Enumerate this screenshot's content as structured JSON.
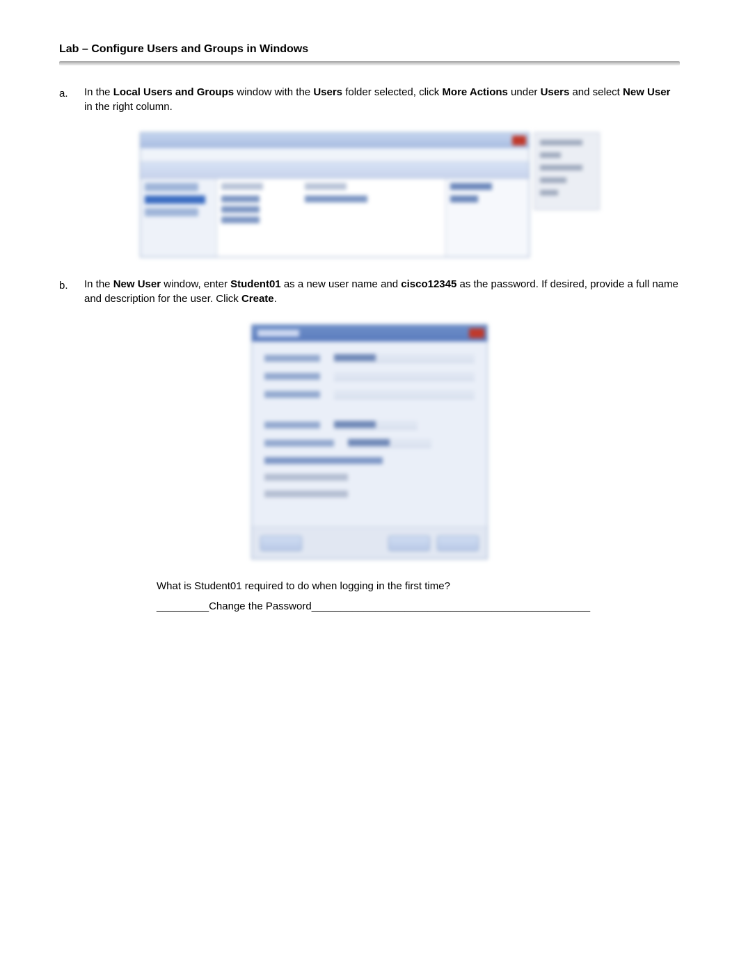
{
  "header": {
    "title": "Lab – Configure Users and Groups in Windows"
  },
  "steps": {
    "a": {
      "letter": "a.",
      "text1_1": "In the ",
      "text1_2": "Local Users and Groups",
      "text1_3": " window with the ",
      "text1_4": "Users",
      "text1_5": " folder selected, click ",
      "text1_6": "More Actions",
      "text1_7": " under ",
      "text1_8": "Users",
      "text1_9": " and select ",
      "text1_10": "New User",
      "text1_11": " in the right column."
    },
    "b": {
      "letter": "b.",
      "text1_1": "In the ",
      "text1_2": "New User",
      "text1_3": " window, enter ",
      "text1_4": "Student01",
      "text1_5": " as a new user name and ",
      "text1_6": "cisco12345",
      "text1_7": " as the password. If desired, provide a full name and description for the user. Click ",
      "text1_8": "Create",
      "text1_9": "."
    }
  },
  "question": "What is Student01 required to do when logging in the first time?",
  "answer_prefix_blank": "_________",
  "answer_text": "Change the Password",
  "answer_suffix_blank": "________________________________________________"
}
